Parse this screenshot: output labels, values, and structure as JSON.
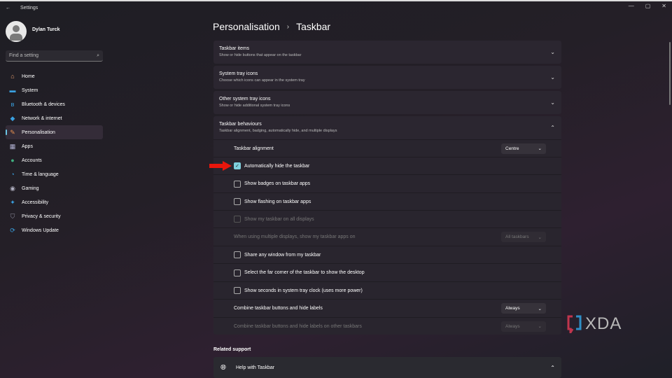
{
  "window": {
    "title": "Settings",
    "back": "←",
    "controls": [
      "—",
      "▢",
      "✕"
    ]
  },
  "user": {
    "name": "Dylan Turck"
  },
  "search": {
    "placeholder": "Find a setting",
    "icon": "⌕"
  },
  "nav": [
    {
      "label": "Home",
      "icon": "⌂",
      "color": "#e8a070"
    },
    {
      "label": "System",
      "icon": "▬",
      "color": "#3aa0e0"
    },
    {
      "label": "Bluetooth & devices",
      "icon": "ʙ",
      "color": "#3aa0e0"
    },
    {
      "label": "Network & internet",
      "icon": "◆",
      "color": "#3aa0e0"
    },
    {
      "label": "Personalisation",
      "icon": "✎",
      "color": "#e89050"
    },
    {
      "label": "Apps",
      "icon": "▦",
      "color": "#b0b0d0"
    },
    {
      "label": "Accounts",
      "icon": "●",
      "color": "#40b080"
    },
    {
      "label": "Time & language",
      "icon": "◔",
      "color": "#3aa0e0"
    },
    {
      "label": "Gaming",
      "icon": "◉",
      "color": "#b0b0c0"
    },
    {
      "label": "Accessibility",
      "icon": "✦",
      "color": "#3aa0e0"
    },
    {
      "label": "Privacy & security",
      "icon": "⛉",
      "color": "#9090a0"
    },
    {
      "label": "Windows Update",
      "icon": "⟳",
      "color": "#3aa0e0"
    }
  ],
  "breadcrumb": {
    "parent": "Personalisation",
    "sep": "›",
    "current": "Taskbar"
  },
  "sections": [
    {
      "title": "Taskbar items",
      "subtitle": "Show or hide buttons that appear on the taskbar",
      "chevron": "⌄"
    },
    {
      "title": "System tray icons",
      "subtitle": "Choose which icons can appear in the system tray",
      "chevron": "⌄"
    },
    {
      "title": "Other system tray icons",
      "subtitle": "Show or hide additional system tray icons",
      "chevron": "⌄"
    },
    {
      "title": "Taskbar behaviours",
      "subtitle": "Taskbar alignment, badging, automatically hide, and multiple displays",
      "chevron": "⌃"
    }
  ],
  "behaviours": {
    "alignment": {
      "label": "Taskbar alignment",
      "value": "Centre"
    },
    "autohide": {
      "label": "Automatically hide the taskbar",
      "checked": true
    },
    "badges": {
      "label": "Show badges on taskbar apps"
    },
    "flashing": {
      "label": "Show flashing on taskbar apps"
    },
    "all_displays": {
      "label": "Show my taskbar on all displays"
    },
    "multi": {
      "label": "When using multiple displays, show my taskbar apps on",
      "value": "All taskbars"
    },
    "share": {
      "label": "Share any window from my taskbar"
    },
    "corner": {
      "label": "Select the far corner of the taskbar to show the desktop"
    },
    "seconds": {
      "label": "Show seconds in system tray clock (uses more power)"
    },
    "combine": {
      "label": "Combine taskbar buttons and hide labels",
      "value": "Always"
    },
    "combine_other": {
      "label": "Combine taskbar buttons and hide labels on other taskbars",
      "value": "Always"
    }
  },
  "related": {
    "title": "Related support",
    "help": "Help with Taskbar",
    "chevron": "⌃"
  },
  "watermark": "XDA"
}
